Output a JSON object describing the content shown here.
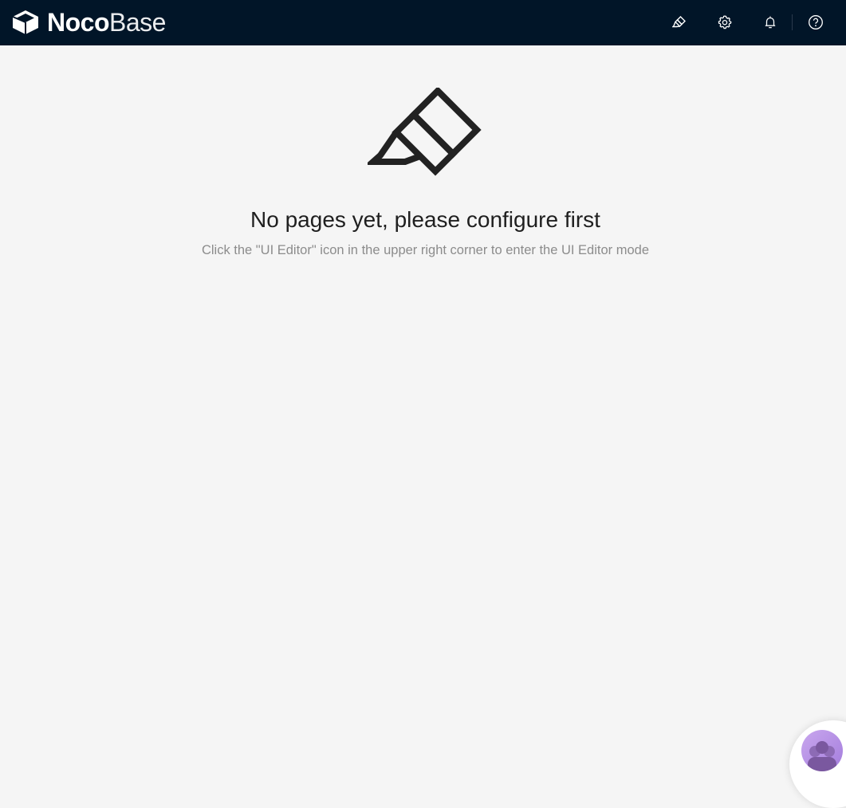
{
  "header": {
    "brand_bold": "Noco",
    "brand_light": "Base",
    "icons": [
      "ui-editor-icon",
      "settings-icon",
      "notification-bell-icon",
      "help-icon",
      "user-icon"
    ]
  },
  "empty_state": {
    "icon": "ui-editor-icon",
    "title": "No pages yet, please configure first",
    "description": "Click the \"UI Editor\" icon in the upper right corner to enter the UI Editor mode"
  },
  "support_widget": {
    "icon": "support-agents-avatar"
  },
  "colors": {
    "header_bg": "#011528",
    "page_bg": "#f5f5f5",
    "title_text": "#1f1f1f",
    "desc_text": "#8c8c8c",
    "icon_dark": "#222222",
    "avatar_purple": "#b18ee6"
  }
}
